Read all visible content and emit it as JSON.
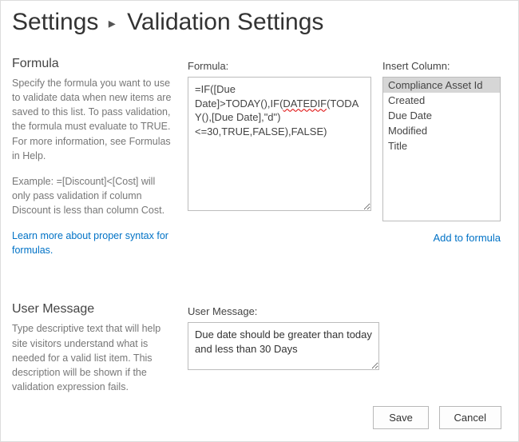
{
  "breadcrumb": {
    "settings": "Settings",
    "page_title": "Validation Settings"
  },
  "formula_section": {
    "title": "Formula",
    "help1": "Specify the formula you want to use to validate data when new items are saved to this list. To pass validation, the formula must evaluate to TRUE. For more information, see Formulas in Help.",
    "help2": "Example: =[Discount]<[Cost] will only pass validation if column Discount is less than column Cost.",
    "syntax_link": "Learn more about proper syntax for formulas.",
    "field_label": "Formula:",
    "formula_pre": "=IF([Due Date]>TODAY(),IF(",
    "formula_err": "DATEDIF",
    "formula_post": "(TODAY(),[Due Date],\"d\")<=30,TRUE,FALSE),FALSE)"
  },
  "columns": {
    "label": "Insert Column:",
    "items": [
      "Compliance Asset Id",
      "Created",
      "Due Date",
      "Modified",
      "Title"
    ],
    "selected_index": 0,
    "add_link": "Add to formula"
  },
  "user_message_section": {
    "title": "User Message",
    "help": "Type descriptive text that will help site visitors understand what is needed for a valid list item. This description will be shown if the validation expression fails.",
    "field_label": "User Message:",
    "value": "Due date should be greater than today and less than 30 Days"
  },
  "buttons": {
    "save": "Save",
    "cancel": "Cancel"
  }
}
